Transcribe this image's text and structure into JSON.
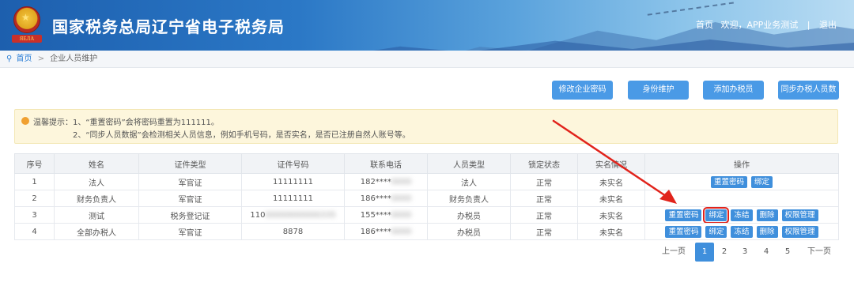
{
  "header": {
    "emblem_text": "ЯЕЛА",
    "title": "国家税务总局辽宁省电子税务局",
    "nav": {
      "home": "首页",
      "welcome": "欢迎，APP业务测试",
      "separator": "|",
      "logout": "退出"
    }
  },
  "breadcrumb": {
    "home": "首页",
    "separator": ">",
    "current": "企业人员维护"
  },
  "actions": {
    "modify_password": "修改企业密码",
    "identity_maintain": "身份维护",
    "add_tax_officer": "添加办税员",
    "sync_tax_staff": "同步办税人员数"
  },
  "notice": {
    "label": "温馨提示：",
    "line1": "1、“重置密码”会将密码重置为111111。",
    "line2": "2、“同步人员数据”会检测相关人员信息，例如手机号码，是否实名，是否已注册自然人账号等。"
  },
  "table": {
    "headers": [
      "序号",
      "姓名",
      "证件类型",
      "证件号码",
      "联系电话",
      "人员类型",
      "锁定状态",
      "实名情况",
      "操作"
    ],
    "rows": [
      {
        "no": "1",
        "name": "法人",
        "id_type": "军官证",
        "id_number": "11111111",
        "id_number_blur": "",
        "phone": "182****",
        "phone_blur": "0000",
        "person_type": "法人",
        "lock_status": "正常",
        "real_name": "未实名",
        "ops": [
          "重置密码",
          "绑定"
        ]
      },
      {
        "no": "2",
        "name": "财务负责人",
        "id_type": "军官证",
        "id_number": "11111111",
        "id_number_blur": "",
        "phone": "186****",
        "phone_blur": "0000",
        "person_type": "财务负责人",
        "lock_status": "正常",
        "real_name": "未实名",
        "ops": []
      },
      {
        "no": "3",
        "name": "测试",
        "id_type": "税务登记证",
        "id_number": "110",
        "id_number_blur": "00000000000335",
        "phone": "155****",
        "phone_blur": "0000",
        "person_type": "办税员",
        "lock_status": "正常",
        "real_name": "未实名",
        "ops": [
          "重置密码",
          "绑定",
          "冻结",
          "删除",
          "权限管理"
        ]
      },
      {
        "no": "4",
        "name": "全部办税人",
        "id_type": "军官证",
        "id_number": "8878",
        "id_number_blur": "",
        "phone": "186****",
        "phone_blur": "0000",
        "person_type": "办税员",
        "lock_status": "正常",
        "real_name": "未实名",
        "ops": [
          "重置密码",
          "绑定",
          "冻结",
          "删除",
          "权限管理"
        ]
      }
    ]
  },
  "pagination": {
    "prev": "上一页",
    "pages": [
      "1",
      "2",
      "3",
      "4",
      "5"
    ],
    "next": "下一页",
    "current": "1"
  },
  "annotation": {
    "arrow_color": "#e1231b",
    "highlight_color": "#e1231b"
  }
}
